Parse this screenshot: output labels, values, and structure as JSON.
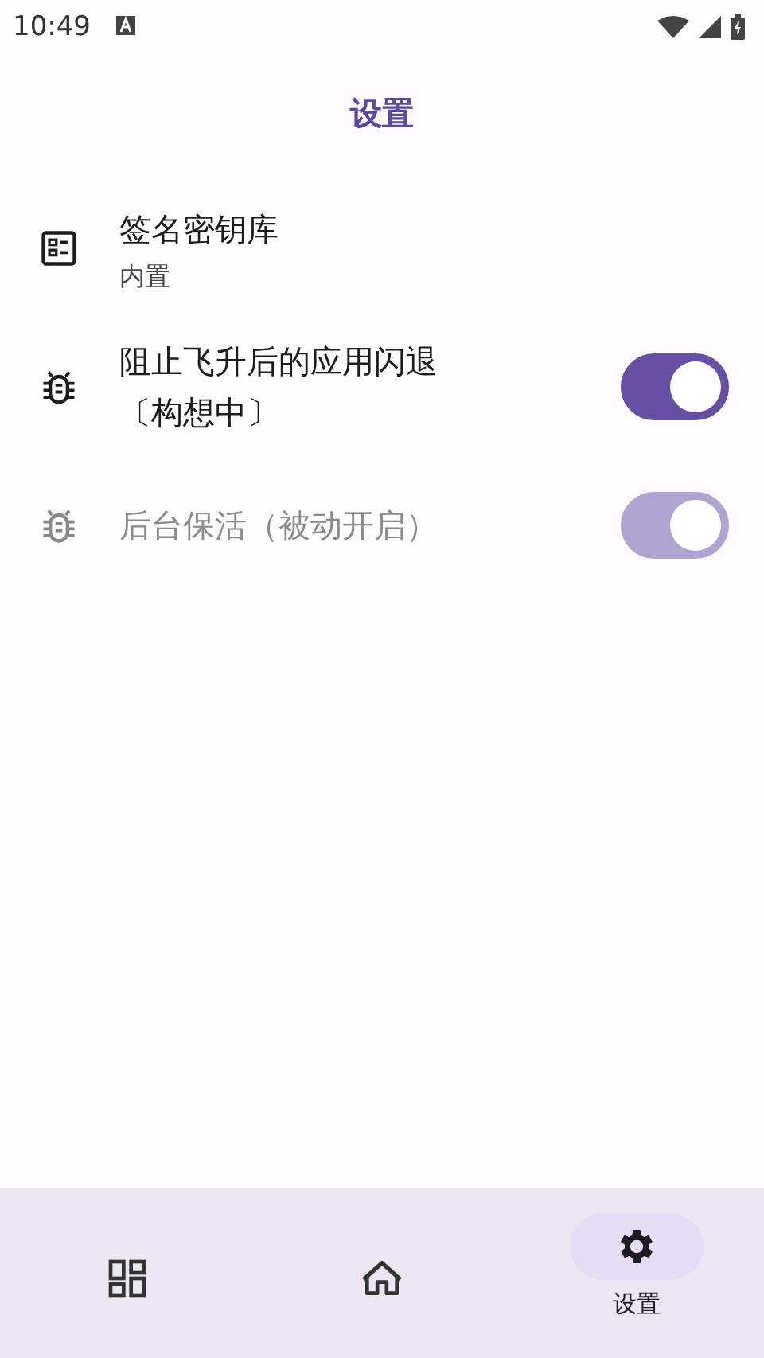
{
  "status_bar": {
    "time": "10:49"
  },
  "title": "设置",
  "items": [
    {
      "kind": "nav",
      "title": "签名密钥库",
      "subtitle": "内置"
    },
    {
      "kind": "switch",
      "title": "阻止飞升后的应用闪退〔构想中〕",
      "on": true,
      "disabled": false
    },
    {
      "kind": "switch",
      "title": "后台保活（被动开启）",
      "on": true,
      "disabled": true
    }
  ],
  "nav": [
    {
      "selected": false
    },
    {
      "selected": false
    },
    {
      "label": "设置",
      "selected": true
    }
  ]
}
